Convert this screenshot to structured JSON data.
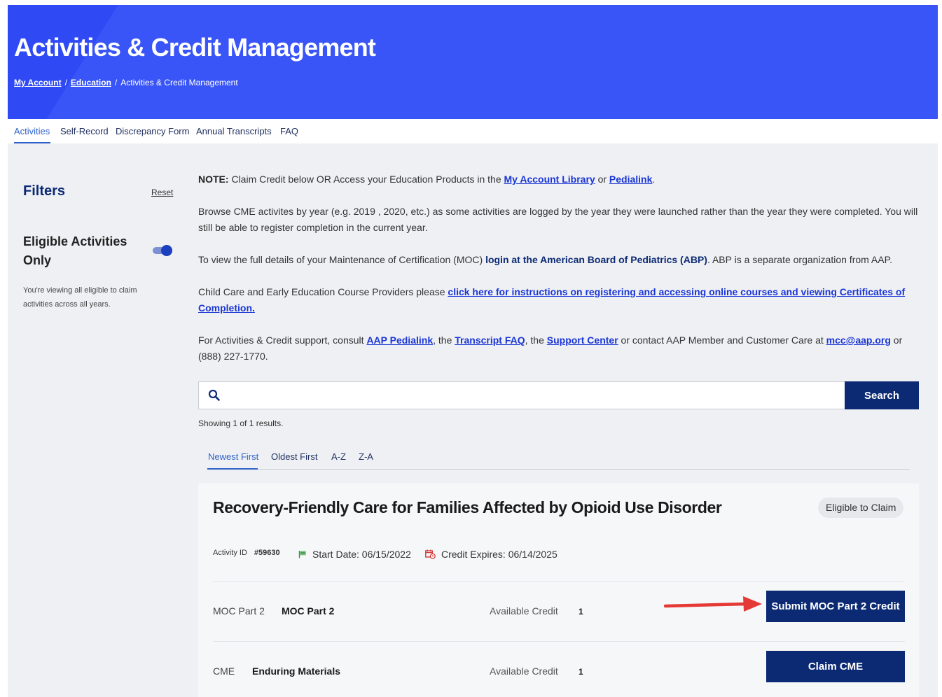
{
  "header": {
    "title": "Activities & Credit Management",
    "breadcrumb": [
      {
        "label": "My Account"
      },
      {
        "label": "Education"
      },
      {
        "label": "Activities & Credit Management"
      }
    ],
    "separator": "/"
  },
  "tabs": [
    {
      "label": "Activities",
      "active": true
    },
    {
      "label": "Self-Record"
    },
    {
      "label": "Discrepancy Form"
    },
    {
      "label": "Annual Transcripts"
    },
    {
      "label": "FAQ"
    }
  ],
  "sidebar": {
    "filters_title": "Filters",
    "reset_label": "Reset",
    "eligible_label": "Eligible Activities Only",
    "eligible_on": true,
    "note": "You're viewing all eligible to claim activities across all years."
  },
  "notes": {
    "note_prefix": "NOTE:",
    "note_text_1": " Claim Credit below OR Access your Education Products in the ",
    "note_link_1": "My Account Library",
    "note_text_2": " or ",
    "note_link_2": "Pedialink",
    "note_text_3": ".",
    "browse": "Browse CME activites by year (e.g. 2019 , 2020, etc.) as some activities are logged by the year they were launched rather than the year they were completed. You will still be able to register completion in the current year.",
    "moc_text_1": "To view the full details of your Maintenance of Certification (MOC) ",
    "moc_link": "login at the American Board of Pediatrics (ABP)",
    "moc_text_2": ". ABP is a separate organization from AAP.",
    "childcare_text": "Child Care and Early Education Course Providers please ",
    "childcare_link": "click here for instructions on registering and accessing online courses and viewing Certificates of Completion.",
    "support_text_1": "For Activities & Credit support, consult ",
    "support_link_1": "AAP Pedialink",
    "support_text_2": ", the ",
    "support_link_2": "Transcript FAQ",
    "support_text_3": ", the ",
    "support_link_3": "Support Center",
    "support_text_4": " or contact AAP Member and Customer Care at ",
    "support_link_4": "mcc@aap.org",
    "support_text_5": " or (888) 227-1770."
  },
  "search": {
    "placeholder": "",
    "value": "",
    "button_label": "Search",
    "results_text": "Showing 1 of 1 results."
  },
  "sort_tabs": [
    {
      "label": "Newest First",
      "active": true
    },
    {
      "label": "Oldest First"
    },
    {
      "label": "A-Z"
    },
    {
      "label": "Z-A"
    }
  ],
  "activity": {
    "title": "Recovery-Friendly Care for Families Affected by Opioid Use Disorder",
    "badge": "Eligible to Claim",
    "id_label": "Activity ID",
    "id_value": "#59630",
    "start_date": "Start Date: 06/15/2022",
    "expires": "Credit Expires: 06/14/2025",
    "credits": [
      {
        "type": "MOC Part 2",
        "name": "MOC Part 2",
        "available_label": "Available Credit",
        "available_value": "1",
        "button": "Submit MOC Part 2 Credit"
      },
      {
        "type": "CME",
        "name": "Enduring Materials",
        "available_label": "Available Credit",
        "available_value": "1",
        "button": "Claim CME"
      }
    ]
  },
  "colors": {
    "banner": "#2f4af5",
    "navy": "#0c2a74",
    "link": "#1b36d6",
    "arrow": "#e53935"
  }
}
